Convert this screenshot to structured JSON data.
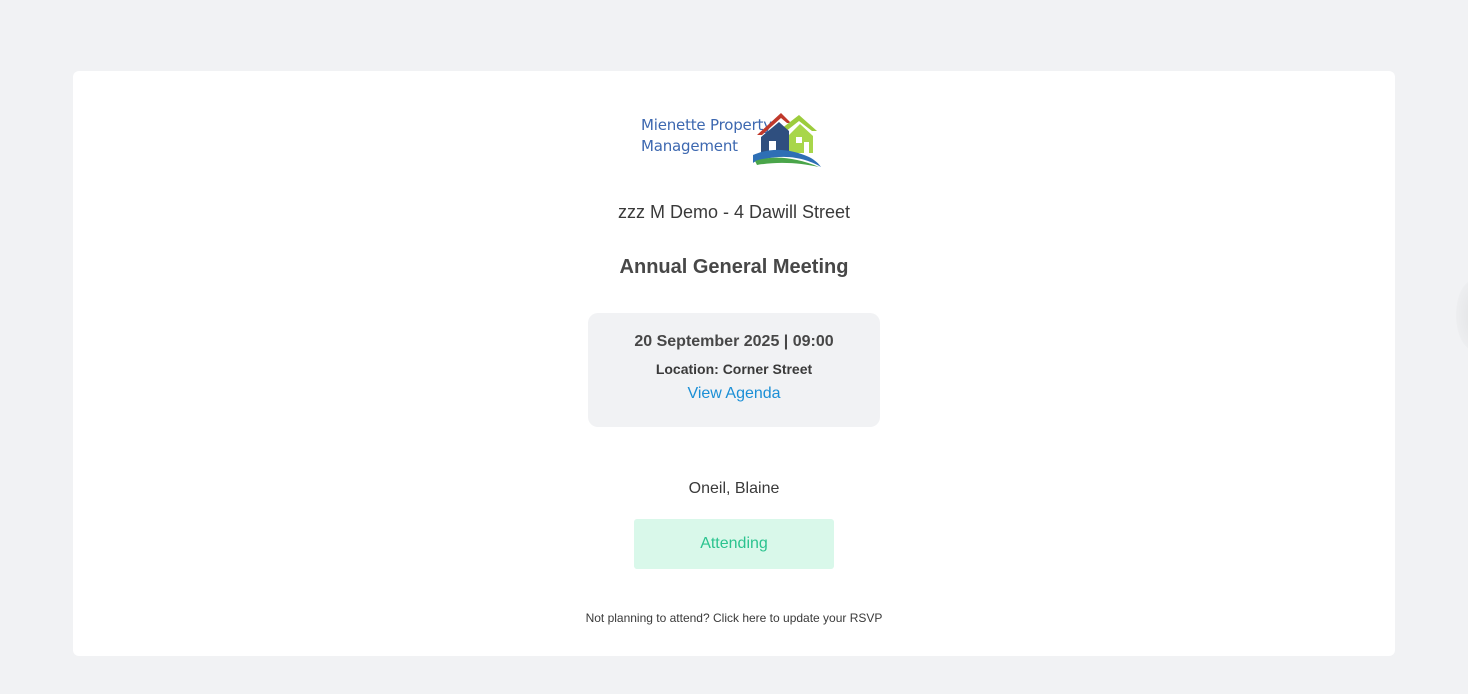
{
  "branding": {
    "company_line1": "Mienette Property",
    "company_line2": "Management",
    "logo_icon": "houses-logo-icon"
  },
  "property": {
    "name": "zzz M Demo - 4 Dawill Street"
  },
  "meeting": {
    "title": "Annual General Meeting",
    "datetime": "20 September 2025 | 09:00",
    "location": "Location: Corner Street",
    "agenda_link": "View Agenda"
  },
  "attendee": {
    "name": "Oneil, Blaine",
    "status": "Attending"
  },
  "rsvp": {
    "note": "Not planning to attend? Click here to update your RSVP"
  },
  "colors": {
    "page_bg": "#f1f2f4",
    "card_bg": "#ffffff",
    "link": "#1b8fd6",
    "status_bg": "#d9f8ea",
    "status_text": "#2bc38f",
    "logo_blue": "#3d68b0"
  }
}
